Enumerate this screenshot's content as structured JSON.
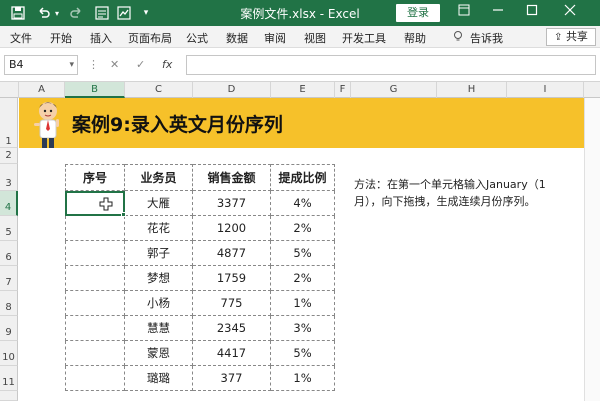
{
  "titlebar": {
    "title": "案例文件.xlsx  -  Excel",
    "login_label": "登录",
    "icons": [
      "save-icon",
      "undo-icon",
      "redo-icon",
      "form-icon",
      "chart-icon",
      "customize-icon"
    ],
    "controls": [
      "ribbon-display-icon",
      "minimize-icon",
      "restore-icon",
      "close-icon"
    ]
  },
  "menu": {
    "items": [
      "文件",
      "开始",
      "插入",
      "页面布局",
      "公式",
      "数据",
      "审阅",
      "视图",
      "开发工具",
      "帮助",
      "告诉我"
    ],
    "share_label": "共享"
  },
  "formula_bar": {
    "name_box": "B4",
    "formula": ""
  },
  "grid": {
    "columns": [
      "A",
      "B",
      "C",
      "D",
      "E",
      "F",
      "G",
      "H",
      "I"
    ],
    "rows": [
      "1",
      "2",
      "3",
      "4",
      "5",
      "6",
      "7",
      "8",
      "9",
      "10",
      "11"
    ],
    "active_column": "B",
    "active_row": "4"
  },
  "banner": {
    "title": "案例9:录入英文月份序列"
  },
  "table": {
    "headers": [
      "序号",
      "业务员",
      "销售金额",
      "提成比例"
    ],
    "rows": [
      [
        "",
        "大雁",
        "3377",
        "4%"
      ],
      [
        "",
        "花花",
        "1200",
        "2%"
      ],
      [
        "",
        "郭子",
        "4877",
        "5%"
      ],
      [
        "",
        "梦想",
        "1759",
        "2%"
      ],
      [
        "",
        "小杨",
        "775",
        "1%"
      ],
      [
        "",
        "慧慧",
        "2345",
        "3%"
      ],
      [
        "",
        "蒙恩",
        "4417",
        "5%"
      ],
      [
        "",
        "璐璐",
        "377",
        "1%"
      ]
    ]
  },
  "note": {
    "line1": "方法：在第一个单元格输入January（1",
    "line2": "月），向下拖拽，生成连续月份序列。"
  },
  "colors": {
    "excel_green": "#217346",
    "banner_yellow": "#f6c12a"
  }
}
